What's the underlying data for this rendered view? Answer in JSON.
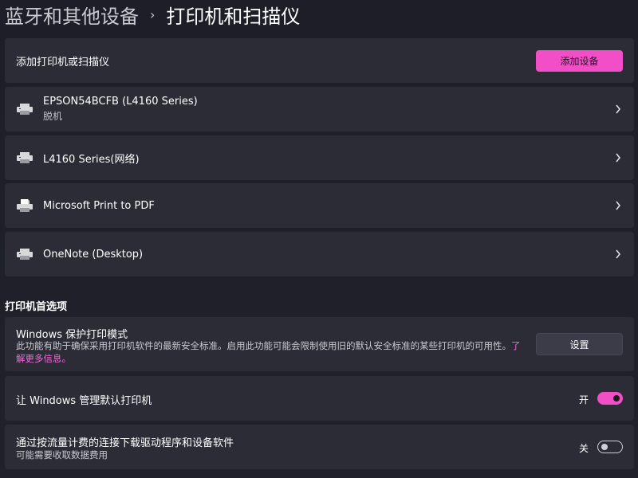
{
  "breadcrumb": {
    "parent": "蓝牙和其他设备",
    "separator": "›",
    "current": "打印机和扫描仪"
  },
  "add_device": {
    "label": "添加打印机或扫描仪",
    "button": "添加设备"
  },
  "printers": [
    {
      "name": "EPSON54BCFB (L4160 Series)",
      "status": "脱机",
      "icon": "printer-icon"
    },
    {
      "name": "L4160 Series(网络)",
      "status": "",
      "icon": "printer-icon"
    },
    {
      "name": "Microsoft Print to PDF",
      "status": "",
      "icon": "pdf-printer-icon"
    },
    {
      "name": "OneNote (Desktop)",
      "status": "",
      "icon": "printer-icon"
    }
  ],
  "preferences": {
    "heading": "打印机首选项",
    "protected_mode": {
      "title": "Windows 保护打印模式",
      "description": "此功能有助于确保采用打印机软件的最新安全标准。启用此功能可能会限制使用旧的默认安全标准的某些打印机的可用性。",
      "link": "了解更多信息。",
      "button": "设置"
    },
    "manage_default": {
      "title": "让 Windows 管理默认打印机",
      "state_label": "开",
      "enabled": true
    },
    "metered_download": {
      "title": "通过按流量计费的连接下载驱动程序和设备软件",
      "subtitle": "可能需要收取数据费用",
      "state_label": "关",
      "enabled": false
    }
  },
  "colors": {
    "accent": "#f24ec8",
    "card": "#2b2c36",
    "background": "#1f2029",
    "link": "#f06ad6"
  }
}
